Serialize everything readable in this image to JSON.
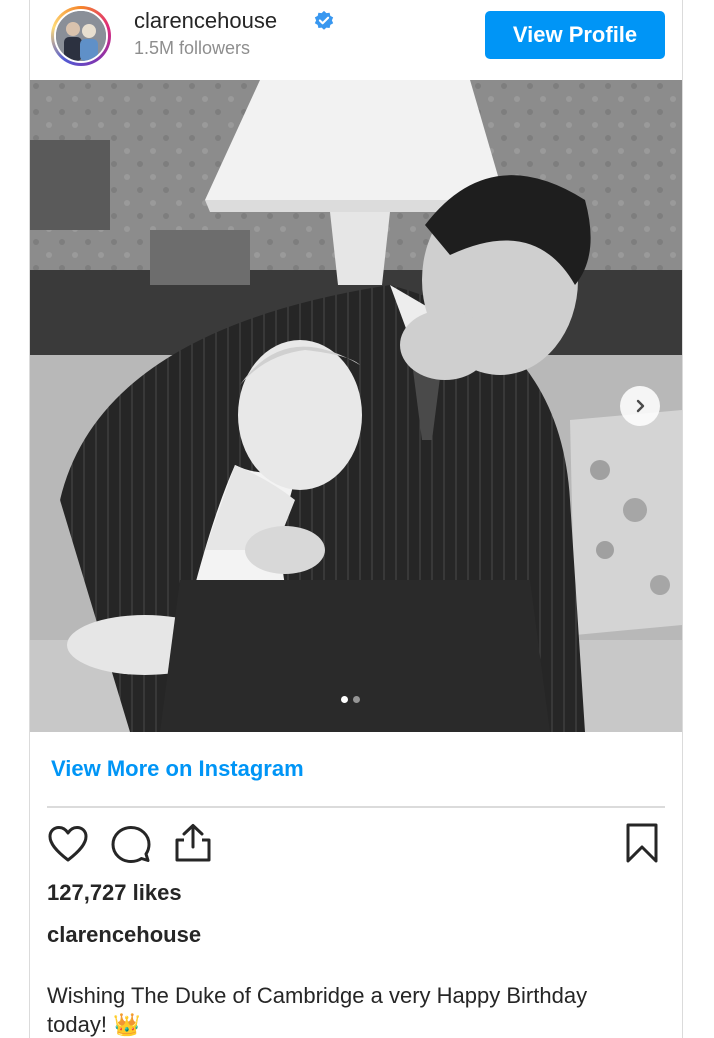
{
  "post": {
    "username": "clarencehouse",
    "followers": "1.5M followers",
    "view_profile_label": "View Profile",
    "view_more_label": "View More on Instagram",
    "likes": "127,727 likes",
    "caption_user": "clarencehouse",
    "caption_text": "Wishing The Duke of Cambridge a very Happy Birthday",
    "caption_line2": "today! 👑"
  },
  "carousel": {
    "total_slides": 2,
    "active_slide": 1
  },
  "icons": [
    "verified-badge-icon",
    "heart-icon",
    "comment-icon",
    "share-icon",
    "bookmark-icon",
    "chevron-right-icon"
  ],
  "colors": {
    "accent": "#0095f6",
    "text": "#262626",
    "muted": "#8e8e8e",
    "border": "#dbdbdb"
  }
}
